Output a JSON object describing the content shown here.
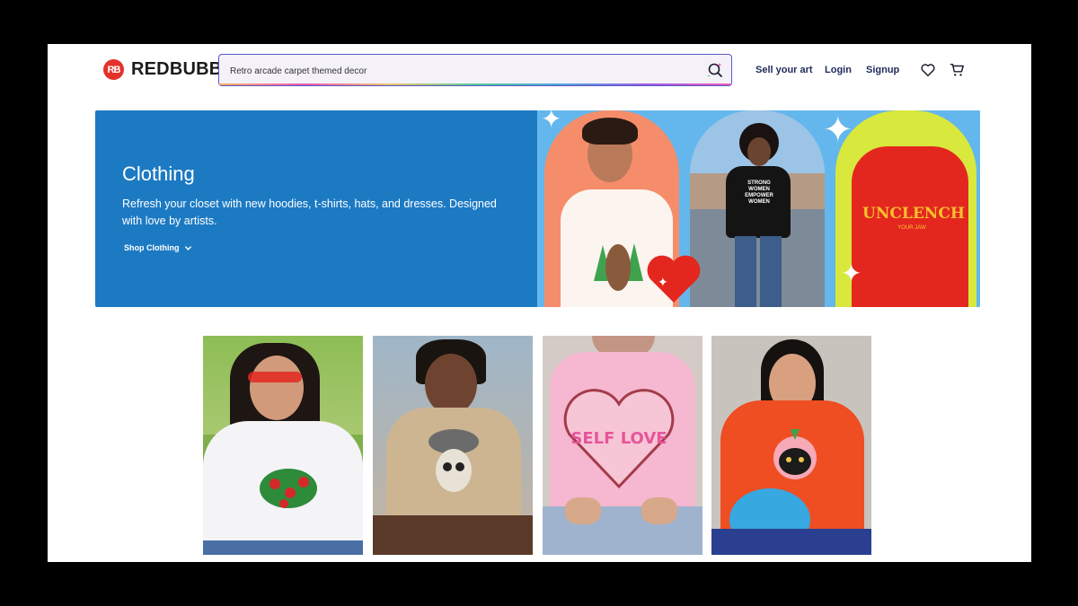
{
  "header": {
    "brand": "REDBUBBLE",
    "brand_mark": "RB",
    "search_value": "Retro arcade carpet themed decor",
    "nav": [
      "Sell your art",
      "Login",
      "Signup"
    ],
    "icons": [
      "search-icon",
      "heart-icon",
      "cart-icon"
    ]
  },
  "hero": {
    "title": "Clothing",
    "description": "Refresh your closet with new hoodies, t-shirts, hats, and dresses. Designed with love by artists.",
    "cta": "Shop Clothing",
    "shirt_text_1": "STRONG WOMEN EMPOWER WOMEN",
    "shirt_text_2": "UNCLENCH",
    "shirt_text_3": "YOUR JAW"
  },
  "products": [
    {
      "name": "strawberry-tshirt",
      "graphic": "strawberries"
    },
    {
      "name": "skull-tshirt",
      "graphic": "skull"
    },
    {
      "name": "self-love-tshirt",
      "graphic_text": "SELF LOVE"
    },
    {
      "name": "cat-tshirt",
      "graphic": "cat"
    }
  ],
  "colors": {
    "brand": "#e4312b",
    "hero_bg": "#1c7ac3",
    "nav_text": "#1f2a5a"
  }
}
